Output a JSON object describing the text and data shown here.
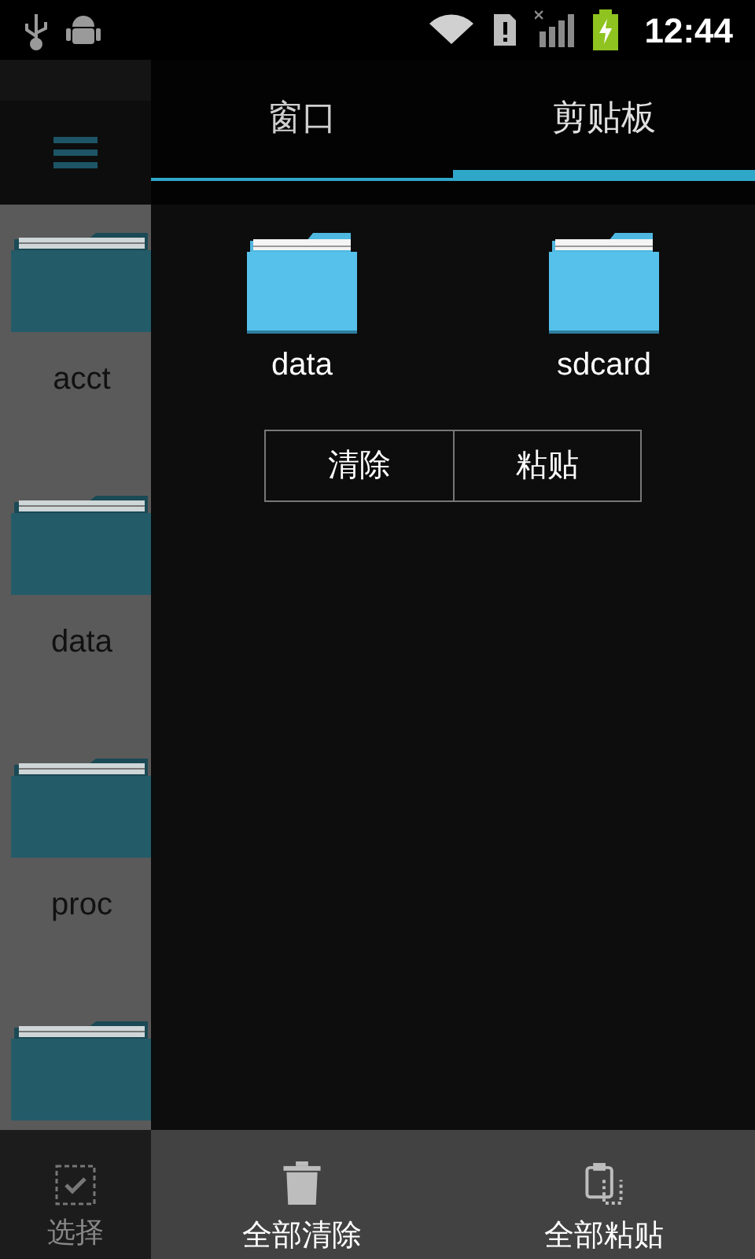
{
  "status_bar": {
    "time": "12:44"
  },
  "folders": [
    {
      "name": "acct"
    },
    {
      "name": "data"
    },
    {
      "name": "proc"
    }
  ],
  "partial_folder": true,
  "bottom_bar": {
    "select_label": "选择"
  },
  "clipboard_panel": {
    "tabs": [
      {
        "label": "窗口",
        "selected": false
      },
      {
        "label": "剪贴板",
        "selected": true
      }
    ],
    "items": [
      {
        "name": "data"
      },
      {
        "name": "sdcard"
      }
    ],
    "actions": [
      "清除",
      "粘贴"
    ],
    "footer": [
      {
        "kind": "trash",
        "label": "全部清除"
      },
      {
        "kind": "paste",
        "label": "全部粘贴"
      }
    ]
  }
}
